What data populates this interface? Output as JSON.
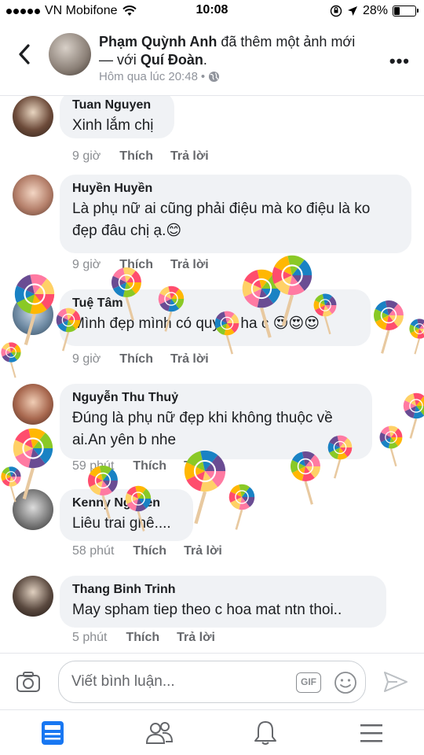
{
  "status_bar": {
    "carrier": "VN Mobifone",
    "time": "10:08",
    "battery": "28%",
    "battery_level": 0.28
  },
  "post_header": {
    "author": "Phạm Quỳnh Anh",
    "action": "đã thêm một ảnh mới",
    "with_prefix": "— với",
    "tagged": "Quí Đoàn",
    "timestamp": "Hôm qua lúc 20:48",
    "separator": "•",
    "more_label": "•••"
  },
  "comments": [
    {
      "name": "Tuan Nguyen",
      "text": "Xinh lắm chị",
      "time": "9 giờ",
      "like": "Thích",
      "reply": "Trả lời"
    },
    {
      "name": "Huyền Huyền",
      "text_line1": "Là phụ nữ ai cũng phải điệu mà ko điệu là ko",
      "text_line2": "đẹp đâu chị ạ.😊",
      "time": "9 giờ",
      "like": "Thích",
      "reply": "Trả lời"
    },
    {
      "name": "Tuệ Tâm",
      "text": "Mình đẹp mình có quyền ha c 😍😍😍",
      "time": "9 giờ",
      "like": "Thích",
      "reply": "Trả lời"
    },
    {
      "name": "Nguyễn Thu Thuỷ",
      "text_line1": "Đúng là phụ nữ đẹp khi không thuộc về",
      "text_line2": "ai.An yên b nhe",
      "time": "59 phút",
      "like": "Thích",
      "reply": "Trả lời"
    },
    {
      "name": "Kenny Nguyen",
      "text": "Liêu trai ghê....",
      "time": "58 phút",
      "like": "Thích",
      "reply": "Trả lời"
    },
    {
      "name": "Thang Binh Trinh",
      "text": "May spham tiep theo c hoa mat ntn thoi..",
      "time": "5 phút",
      "like": "Thích",
      "reply": "Trả lời"
    }
  ],
  "composer": {
    "placeholder": "Viết bình luận...",
    "gif_label": "GIF"
  },
  "icons": {
    "back": "back-arrow-icon",
    "more": "more-icon",
    "camera": "camera-icon",
    "gif": "gif-icon",
    "emoji": "emoji-icon",
    "send": "send-icon",
    "tabs": [
      "news-feed-icon",
      "friends-icon",
      "notifications-icon",
      "menu-icon"
    ]
  },
  "colors": {
    "bubble": "#f0f2f5",
    "tab_active": "#1877f2",
    "text_secondary": "#65676b"
  }
}
